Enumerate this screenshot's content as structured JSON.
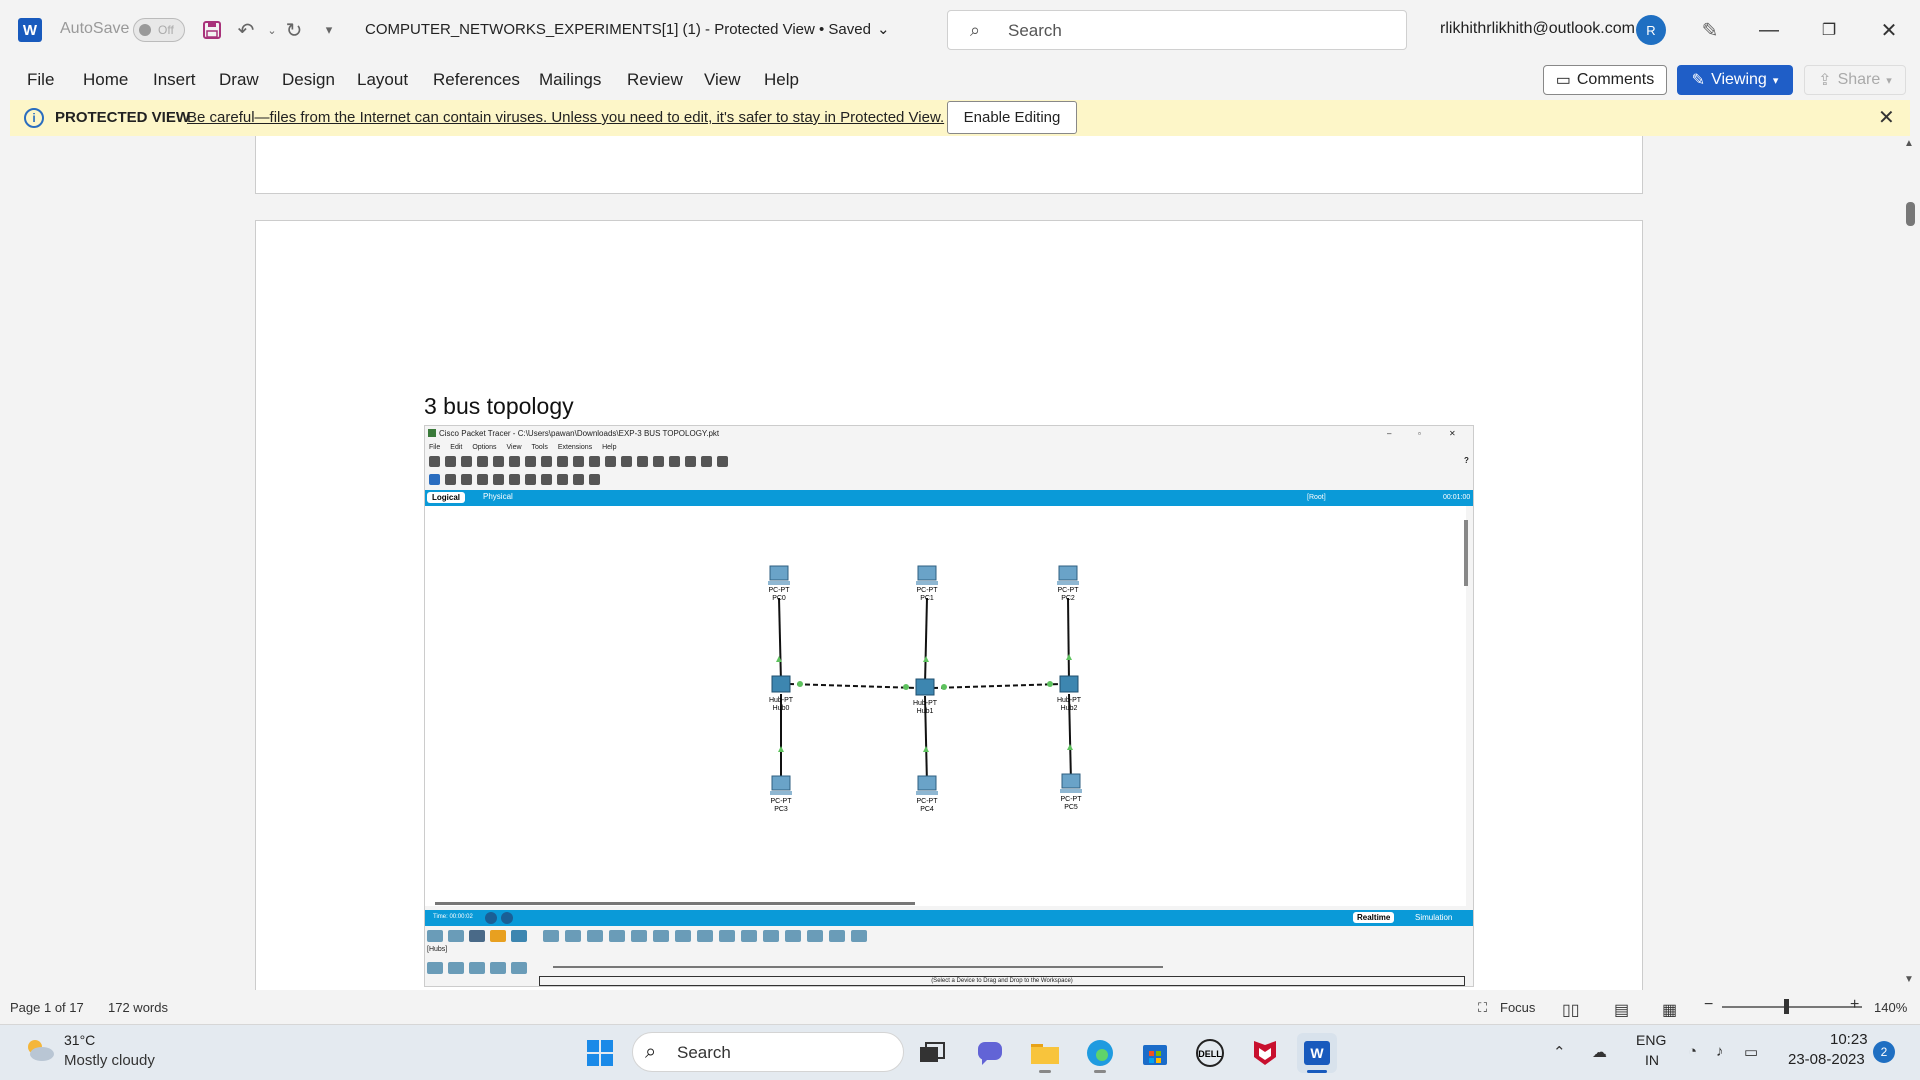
{
  "window": {
    "app_badge": "W",
    "autosave_label": "AutoSave",
    "autosave_state": "Off",
    "doc_title": "COMPUTER_NETWORKS_EXPERIMENTS[1] (1)  -  Protected View • Saved",
    "search_placeholder": "Search",
    "account_email": "rlikhithrlikhith@outlook.com",
    "avatar_initial": "R"
  },
  "menu": {
    "items": [
      "File",
      "Home",
      "Insert",
      "Draw",
      "Design",
      "Layout",
      "References",
      "Mailings",
      "Review",
      "View",
      "Help"
    ],
    "comments_label": "Comments",
    "viewing_label": "Viewing",
    "share_label": "Share"
  },
  "protected_view": {
    "title": "PROTECTED VIEW",
    "message": "Be careful—files from the Internet can contain viruses. Unless you need to edit, it's safer to stay in Protected View.",
    "enable_button": "Enable Editing"
  },
  "document": {
    "heading": "3 bus topology",
    "embedded_screenshot": {
      "window_title": "Cisco Packet Tracer - C:\\Users\\pawan\\Downloads\\EXP-3 BUS TOPOLOGY.pkt",
      "menus": [
        "File",
        "Edit",
        "Options",
        "View",
        "Tools",
        "Extensions",
        "Help"
      ],
      "tab_logical": "Logical",
      "tab_physical": "Physical",
      "root_label": "[Root]",
      "clock": "00:01:00",
      "time_label": "Time: 00:00:02",
      "realtime_label": "Realtime",
      "simulation_label": "Simulation",
      "device_category": "[Hubs]",
      "hint": "(Select a Device to Drag and Drop to the Workspace)",
      "nodes": {
        "pc0": {
          "type": "PC-PT",
          "name": "PC0"
        },
        "pc1": {
          "type": "PC-PT",
          "name": "PC1"
        },
        "pc2": {
          "type": "PC-PT",
          "name": "PC2"
        },
        "hub0": {
          "type": "Hub-PT",
          "name": "Hub0"
        },
        "hub1": {
          "type": "Hub-PT",
          "name": "Hub1"
        },
        "hub2": {
          "type": "Hub-PT",
          "name": "Hub2"
        },
        "pc3": {
          "type": "PC-PT",
          "name": "PC3"
        },
        "pc4": {
          "type": "PC-PT",
          "name": "PC4"
        },
        "pc5": {
          "type": "PC-PT",
          "name": "PC5"
        }
      }
    }
  },
  "status": {
    "page": "Page 1 of 17",
    "words": "172 words",
    "focus": "Focus",
    "zoom": "140%"
  },
  "taskbar": {
    "temperature": "31°C",
    "weather": "Mostly cloudy",
    "search": "Search",
    "lang_line1": "ENG",
    "lang_line2": "IN",
    "time": "10:23",
    "date": "23-08-2023",
    "notifications": "2"
  },
  "colors": {
    "word_blue": "#185abd",
    "viewing_button": "#1f5ec7",
    "protected_bar": "#fdf6c8",
    "packet_tracer_bar": "#0a9ad8"
  }
}
